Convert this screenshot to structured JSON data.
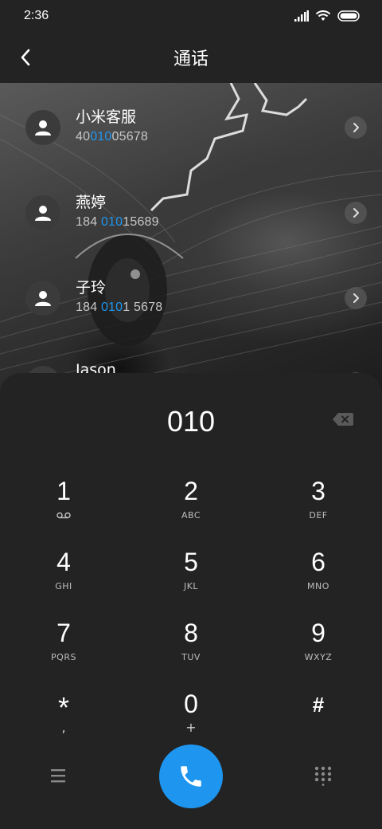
{
  "status": {
    "time": "2:36",
    "icons": [
      "signal-icon",
      "wifi-icon",
      "battery-icon"
    ]
  },
  "header": {
    "title": "通话",
    "back_icon": "chevron-left-icon"
  },
  "results": [
    {
      "name": "小米客服",
      "number_parts": [
        "40",
        "010",
        "05678"
      ],
      "avatar_icon": "person-icon",
      "detail_icon": "chevron-right-icon"
    },
    {
      "name": "燕婷",
      "number_parts": [
        "184 ",
        "010",
        "15689"
      ],
      "avatar_icon": "person-icon",
      "detail_icon": "chevron-right-icon"
    },
    {
      "name": "子玲",
      "number_parts": [
        "184 ",
        "010",
        "1 5678"
      ],
      "avatar_icon": "person-icon",
      "detail_icon": "chevron-right-icon"
    },
    {
      "name": "Jason",
      "avatar_icon": "person-icon",
      "detail_icon": "chevron-right-icon"
    }
  ],
  "dialer": {
    "input": "010",
    "backspace_icon": "backspace-icon",
    "keys": [
      {
        "digit": "1",
        "sub": "voicemail-icon"
      },
      {
        "digit": "2",
        "letters": "ABC"
      },
      {
        "digit": "3",
        "letters": "DEF"
      },
      {
        "digit": "4",
        "letters": "GHI"
      },
      {
        "digit": "5",
        "letters": "JKL"
      },
      {
        "digit": "6",
        "letters": "MNO"
      },
      {
        "digit": "7",
        "letters": "PQRS"
      },
      {
        "digit": "8",
        "letters": "TUV"
      },
      {
        "digit": "9",
        "letters": "WXYZ"
      },
      {
        "digit": "*",
        "sub": ","
      },
      {
        "digit": "0",
        "sub": "+"
      },
      {
        "digit": "#"
      }
    ],
    "bottom": {
      "menu_icon": "menu-icon",
      "call_icon": "phone-icon",
      "keypad_icon": "dialpad-icon"
    }
  },
  "colors": {
    "accent": "#1e96f0",
    "background": "#232323"
  }
}
